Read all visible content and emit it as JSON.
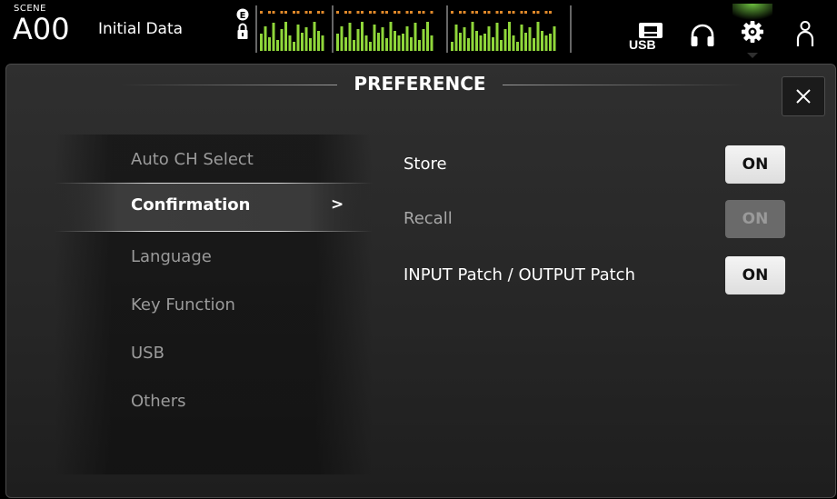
{
  "topbar": {
    "scene_label": "SCENE",
    "scene_number": "A00",
    "scene_title": "Initial Data",
    "usb_label": "USB",
    "icons": [
      "e-badge-icon",
      "lock-icon",
      "usb-icon",
      "headphones-icon",
      "gear-icon",
      "user-icon"
    ]
  },
  "preference": {
    "title": "PREFERENCE",
    "close_label": "×"
  },
  "menu": {
    "items": [
      {
        "label": "Auto CH Select",
        "active": false
      },
      {
        "label": "Confirmation",
        "active": true
      },
      {
        "label": "Language",
        "active": false
      },
      {
        "label": "Key Function",
        "active": false
      },
      {
        "label": "USB",
        "active": false
      },
      {
        "label": "Others",
        "active": false
      }
    ],
    "active_indicator": ">"
  },
  "confirmation": {
    "settings": [
      {
        "label": "Store",
        "state": "ON",
        "enabled": true
      },
      {
        "label": "Recall",
        "state": "ON",
        "enabled": false
      },
      {
        "label": "INPUT Patch / OUTPUT Patch",
        "state": "ON",
        "enabled": true
      }
    ]
  },
  "colors": {
    "meter_green": "#8fd63a",
    "meter_orange": "#e0892a",
    "gear_glow": "#7fe04a"
  }
}
